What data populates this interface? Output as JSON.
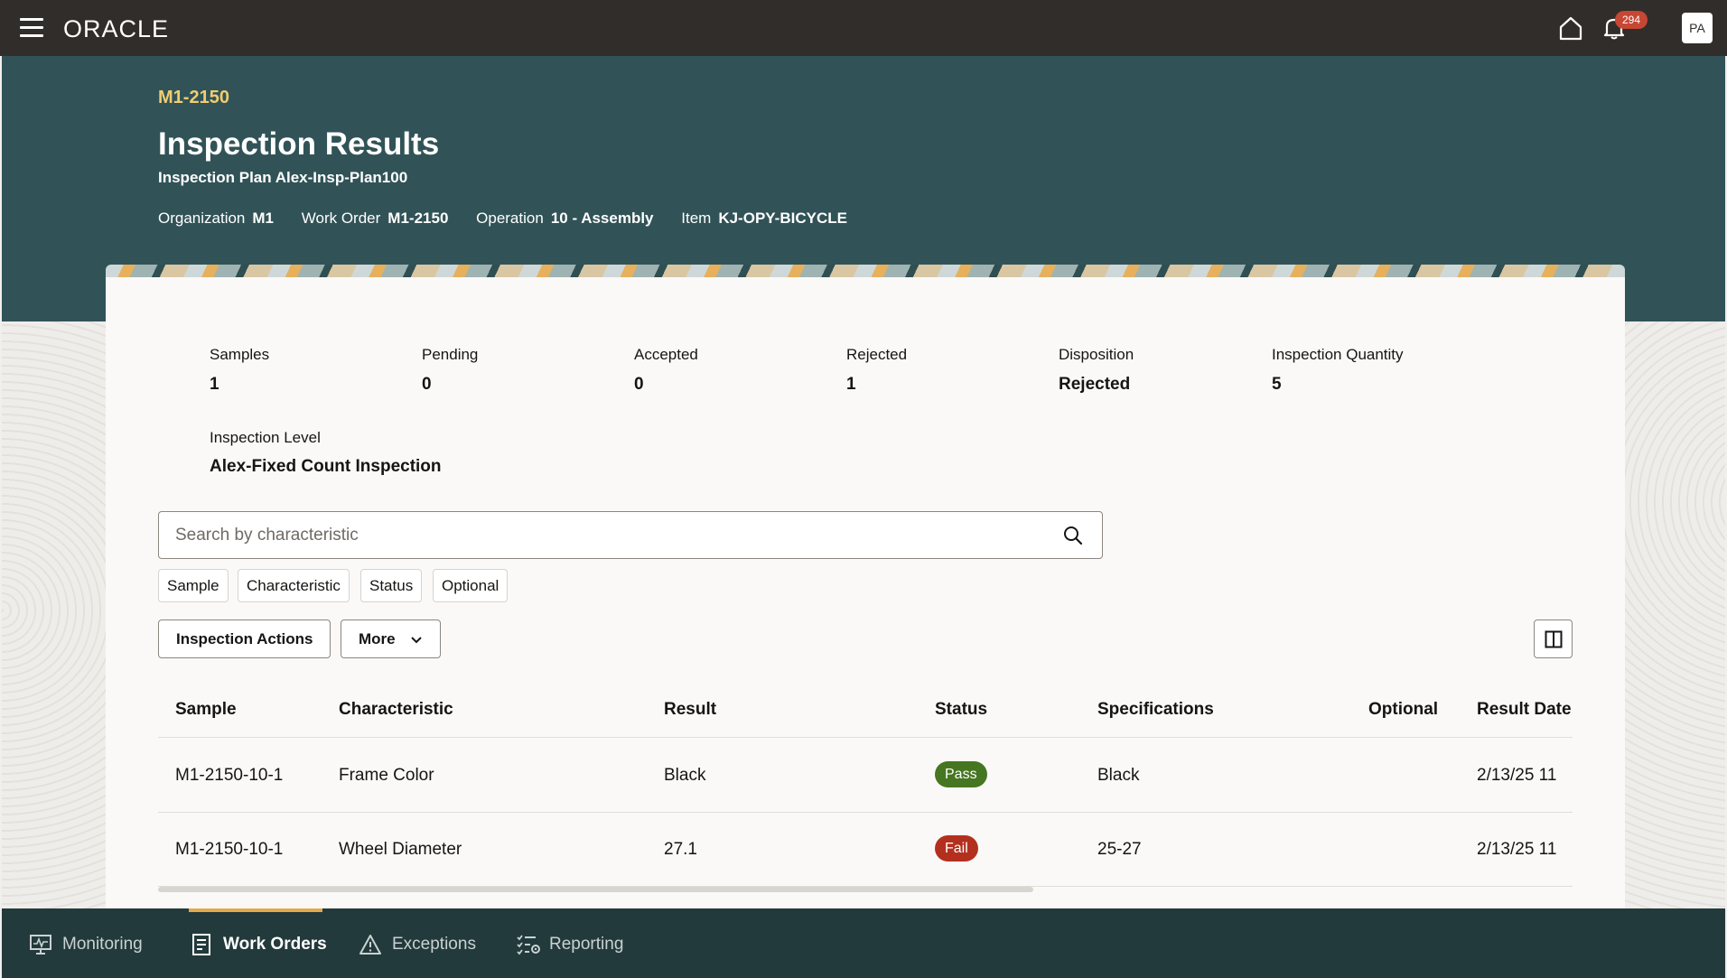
{
  "topbar": {
    "brand": "ORACLE",
    "notification_count": "294",
    "avatar_initials": "PA"
  },
  "header": {
    "work_order_id": "M1-2150",
    "title": "Inspection Results",
    "subtitle": "Inspection Plan Alex-Insp-Plan100",
    "meta": [
      {
        "label": "Organization",
        "value": "M1"
      },
      {
        "label": "Work Order",
        "value": "M1-2150"
      },
      {
        "label": "Operation",
        "value": "10 - Assembly"
      },
      {
        "label": "Item",
        "value": "KJ-OPY-BICYCLE"
      }
    ]
  },
  "summary": {
    "stats": [
      {
        "label": "Samples",
        "value": "1"
      },
      {
        "label": "Pending",
        "value": "0"
      },
      {
        "label": "Accepted",
        "value": "0"
      },
      {
        "label": "Rejected",
        "value": "1"
      },
      {
        "label": "Disposition",
        "value": "Rejected"
      },
      {
        "label": "Inspection Quantity",
        "value": "5"
      }
    ],
    "level_label": "Inspection Level",
    "level_value": "Alex-Fixed Count Inspection"
  },
  "search": {
    "placeholder": "Search by characteristic",
    "value": ""
  },
  "filter_chips": [
    "Sample",
    "Characteristic",
    "Status",
    "Optional"
  ],
  "actions": {
    "inspection_actions": "Inspection Actions",
    "more": "More"
  },
  "table": {
    "columns": [
      "Sample",
      "Characteristic",
      "Result",
      "Status",
      "Specifications",
      "Optional",
      "Result Date"
    ],
    "rows": [
      {
        "sample": "M1-2150-10-1",
        "characteristic": "Frame Color",
        "result": "Black",
        "status": "Pass",
        "specifications": "Black",
        "optional": "",
        "result_date": "2/13/25 11"
      },
      {
        "sample": "M1-2150-10-1",
        "characteristic": "Wheel Diameter",
        "result": "27.1",
        "status": "Fail",
        "specifications": "25-27",
        "optional": "",
        "result_date": "2/13/25 11"
      }
    ]
  },
  "colors": {
    "pass": "#467621",
    "fail": "#b3301f",
    "header_bg": "#315357",
    "accent": "#f0cc71"
  },
  "bottom_nav": [
    {
      "label": "Monitoring",
      "icon": "monitor-icon",
      "active": false
    },
    {
      "label": "Work Orders",
      "icon": "document-icon",
      "active": true
    },
    {
      "label": "Exceptions",
      "icon": "warning-icon",
      "active": false
    },
    {
      "label": "Reporting",
      "icon": "report-icon",
      "active": false
    }
  ]
}
